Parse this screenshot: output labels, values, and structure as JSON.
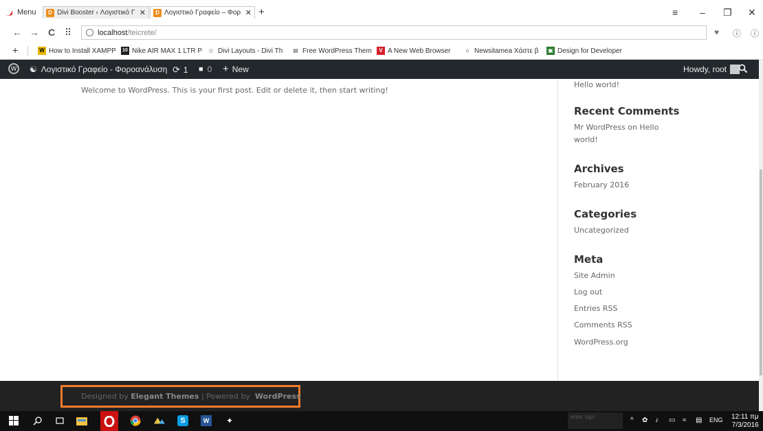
{
  "browser": {
    "menu_label": "Menu",
    "tabs": [
      {
        "label": "Divi Booster ‹ Λογιστικό Γ"
      },
      {
        "label": "Λογιστικό Γραφείο – Φορ"
      }
    ],
    "new_tab": "+",
    "controls": {
      "filter": "≡",
      "minimize": "–",
      "restore": "❐",
      "close": "✕"
    }
  },
  "address": {
    "host": "localhost",
    "path": "/teicrete/"
  },
  "bookmarks": [
    {
      "label": "How to Install XAMPP",
      "color": "#e8b800",
      "icon_text": "W"
    },
    {
      "label": "Nike AIR MAX 1 LTR P",
      "color": "#222222",
      "icon_text": "10"
    },
    {
      "label": "Divi Layouts - Divi Th",
      "color": "#999999",
      "icon_text": "◎"
    },
    {
      "label": "Free WordPress Them",
      "color": "#555555",
      "icon_text": "▤"
    },
    {
      "label": "A New Web Browser",
      "color": "#d6202a",
      "icon_text": "V"
    },
    {
      "label": "Newsitamea Χάστε β",
      "color": "#333333",
      "icon_text": "⌂"
    },
    {
      "label": "Design for Developer",
      "color": "#2e7d32",
      "icon_text": "▣"
    }
  ],
  "adminbar": {
    "site_name": "Λογιστικό Γραφείο - Φοροανάλυση",
    "updates_count": "1",
    "comments_count": "0",
    "new_label": "New",
    "howdy": "Howdy, root"
  },
  "post": {
    "text": "Welcome to WordPress. This is your first post. Edit or delete it, then start writing!"
  },
  "sidebar": {
    "recent_post": "Hello world!",
    "recent_comments_title": "Recent Comments",
    "recent_comment_line1": "Mr WordPress on Hello",
    "recent_comment_line2": "world!",
    "archives_title": "Archives",
    "archive_item": "February 2016",
    "categories_title": "Categories",
    "category_item": "Uncategorized",
    "meta_title": "Meta",
    "meta_items": [
      "Site Admin",
      "Log out",
      "Entries RSS",
      "Comments RSS",
      "WordPress.org"
    ]
  },
  "footer": {
    "prefix": "Designed by ",
    "brand1": "Elegant Themes",
    "sep": " | Powered by ",
    "brand2": "WordPress"
  },
  "taskbar": {
    "search_placeholder": "enter sign",
    "lang": "ENG",
    "time": "12:11 πμ",
    "date": "7/3/2016"
  }
}
